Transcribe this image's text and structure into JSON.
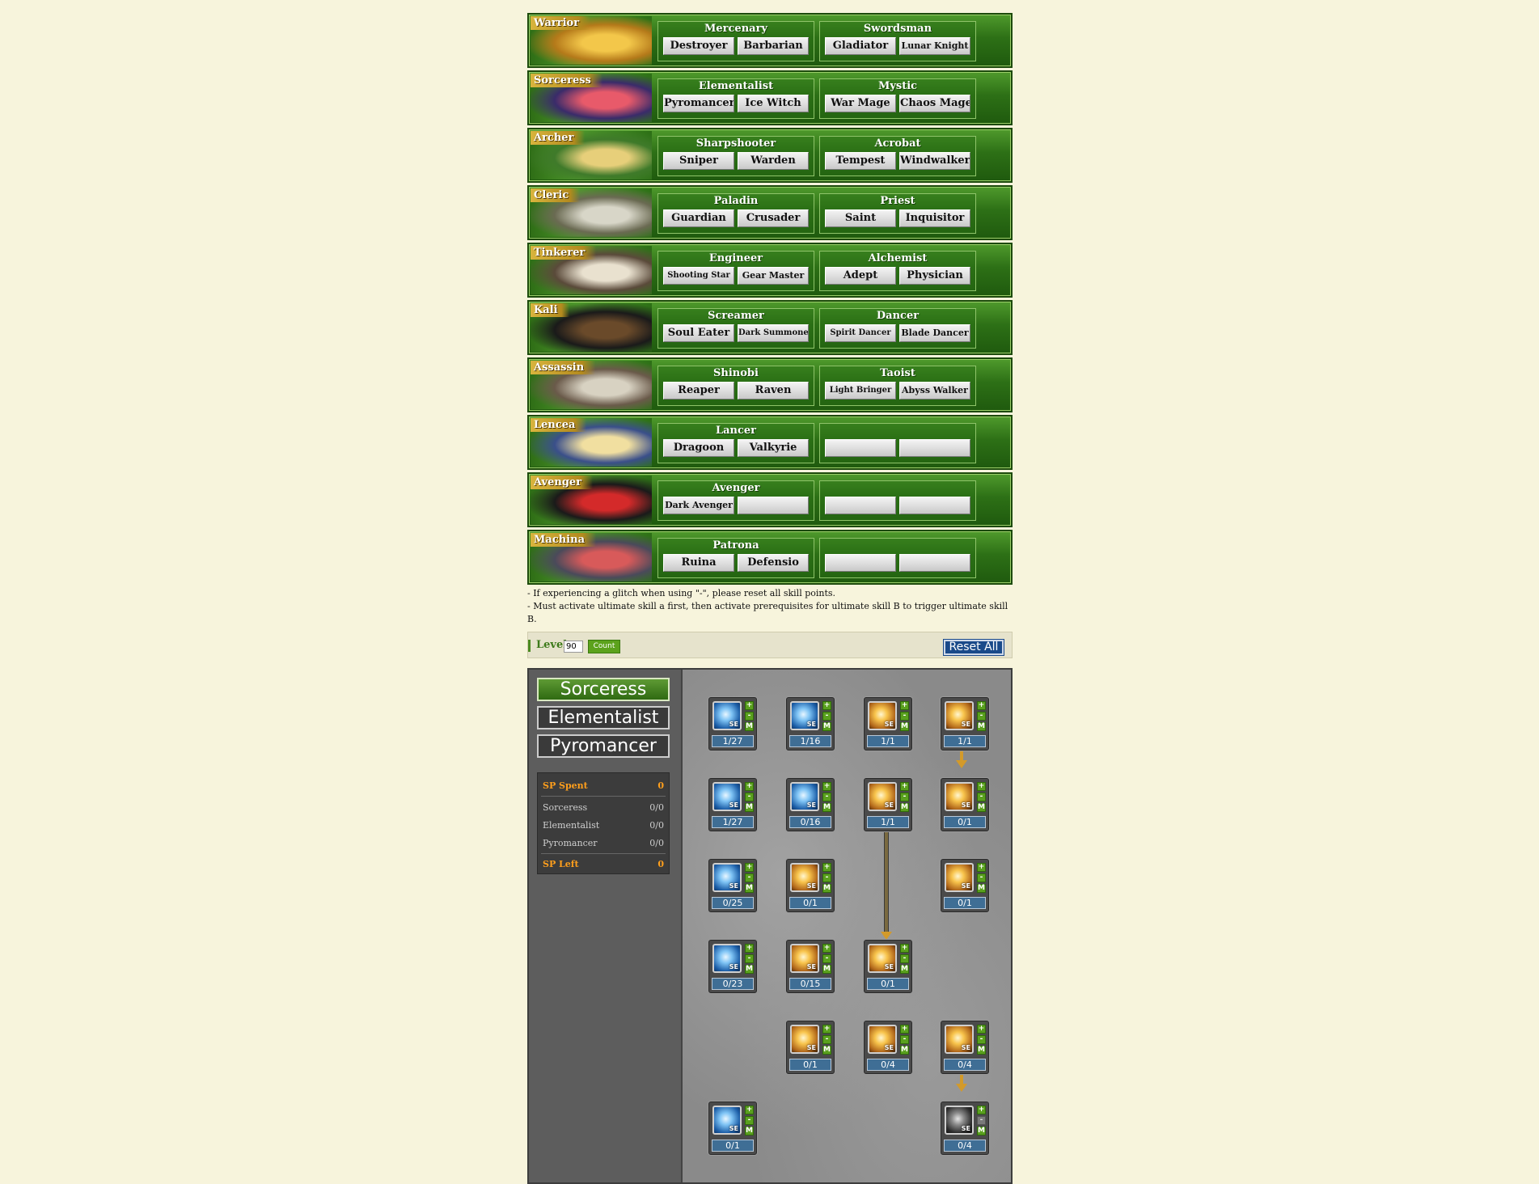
{
  "classes": [
    {
      "name": "Warrior",
      "groups": [
        {
          "title": "Mercenary",
          "jobs": [
            "Destroyer",
            "Barbarian"
          ]
        },
        {
          "title": "Swordsman",
          "jobs": [
            "Gladiator",
            "Lunar Knight"
          ]
        }
      ]
    },
    {
      "name": "Sorceress",
      "groups": [
        {
          "title": "Elementalist",
          "jobs": [
            "Pyromancer",
            "Ice Witch"
          ]
        },
        {
          "title": "Mystic",
          "jobs": [
            "War Mage",
            "Chaos Mage"
          ]
        }
      ]
    },
    {
      "name": "Archer",
      "groups": [
        {
          "title": "Sharpshooter",
          "jobs": [
            "Sniper",
            "Warden"
          ]
        },
        {
          "title": "Acrobat",
          "jobs": [
            "Tempest",
            "Windwalker"
          ]
        }
      ]
    },
    {
      "name": "Cleric",
      "groups": [
        {
          "title": "Paladin",
          "jobs": [
            "Guardian",
            "Crusader"
          ]
        },
        {
          "title": "Priest",
          "jobs": [
            "Saint",
            "Inquisitor"
          ]
        }
      ]
    },
    {
      "name": "Tinkerer",
      "groups": [
        {
          "title": "Engineer",
          "jobs": [
            "Shooting Star",
            "Gear Master"
          ]
        },
        {
          "title": "Alchemist",
          "jobs": [
            "Adept",
            "Physician"
          ]
        }
      ]
    },
    {
      "name": "Kali",
      "groups": [
        {
          "title": "Screamer",
          "jobs": [
            "Soul Eater",
            "Dark Summoner"
          ]
        },
        {
          "title": "Dancer",
          "jobs": [
            "Spirit Dancer",
            "Blade Dancer"
          ]
        }
      ]
    },
    {
      "name": "Assassin",
      "groups": [
        {
          "title": "Shinobi",
          "jobs": [
            "Reaper",
            "Raven"
          ]
        },
        {
          "title": "Taoist",
          "jobs": [
            "Light Bringer",
            "Abyss Walker"
          ]
        }
      ]
    },
    {
      "name": "Lencea",
      "groups": [
        {
          "title": "Lancer",
          "jobs": [
            "Dragoon",
            "Valkyrie"
          ]
        },
        {
          "title": "",
          "jobs": [
            "",
            ""
          ]
        }
      ]
    },
    {
      "name": "Avenger",
      "groups": [
        {
          "title": "Avenger",
          "jobs": [
            "Dark Avenger",
            ""
          ]
        },
        {
          "title": "",
          "jobs": [
            "",
            ""
          ]
        }
      ]
    },
    {
      "name": "Machina",
      "groups": [
        {
          "title": "Patrona",
          "jobs": [
            "Ruina",
            "Defensio"
          ]
        },
        {
          "title": "",
          "jobs": [
            "",
            ""
          ]
        }
      ]
    }
  ],
  "notes": [
    "- If experiencing a glitch when using \"-\", please reset all skill points.",
    "- Must activate ultimate skill a first, then activate prerequisites for ultimate skill B to trigger ultimate skill B."
  ],
  "level": {
    "label": "Level",
    "value": "90",
    "count_label": "Count",
    "reset_label": "Reset All"
  },
  "tree": {
    "tabs": [
      "Sorceress",
      "Elementalist",
      "Pyromancer"
    ],
    "sp": {
      "spent_label": "SP Spent",
      "spent_value": "0",
      "rows": [
        {
          "label": "Sorceress",
          "value": "0/0"
        },
        {
          "label": "Elementalist",
          "value": "0/0"
        },
        {
          "label": "Pyromancer",
          "value": "0/0"
        }
      ],
      "left_label": "SP Left",
      "left_value": "0"
    },
    "skill_tag": "SE",
    "btn_plus": "+",
    "btn_minus": "-",
    "btn_max": "M",
    "skills": [
      {
        "level": "1/27",
        "type": "ice"
      },
      {
        "level": "1/16",
        "type": "ice"
      },
      {
        "level": "1/1",
        "type": "fire"
      },
      {
        "level": "1/1",
        "type": "fire"
      },
      {
        "level": "1/27",
        "type": "ice"
      },
      {
        "level": "0/16",
        "type": "ice"
      },
      {
        "level": "1/1",
        "type": "fire"
      },
      {
        "level": "0/1",
        "type": "fire"
      },
      {
        "level": "0/25",
        "type": "ice"
      },
      {
        "level": "0/1",
        "type": "fire"
      },
      {
        "level": "0/1",
        "type": "fire"
      },
      {
        "level": "0/23",
        "type": "ice"
      },
      {
        "level": "0/15",
        "type": "fire"
      },
      {
        "level": "0/1",
        "type": "fire"
      },
      {
        "level": "0/1",
        "type": "fire"
      },
      {
        "level": "0/4",
        "type": "fire"
      },
      {
        "level": "0/4",
        "type": "fire"
      },
      {
        "level": "0/1",
        "type": "ice"
      },
      {
        "level": "0/4",
        "type": "dark"
      }
    ]
  },
  "colors": {
    "accent_green": "#2d7016",
    "level_blue": "#3f6e95",
    "sp_orange": "#ff9f1c",
    "arrow_gold": "#d39a2a"
  }
}
